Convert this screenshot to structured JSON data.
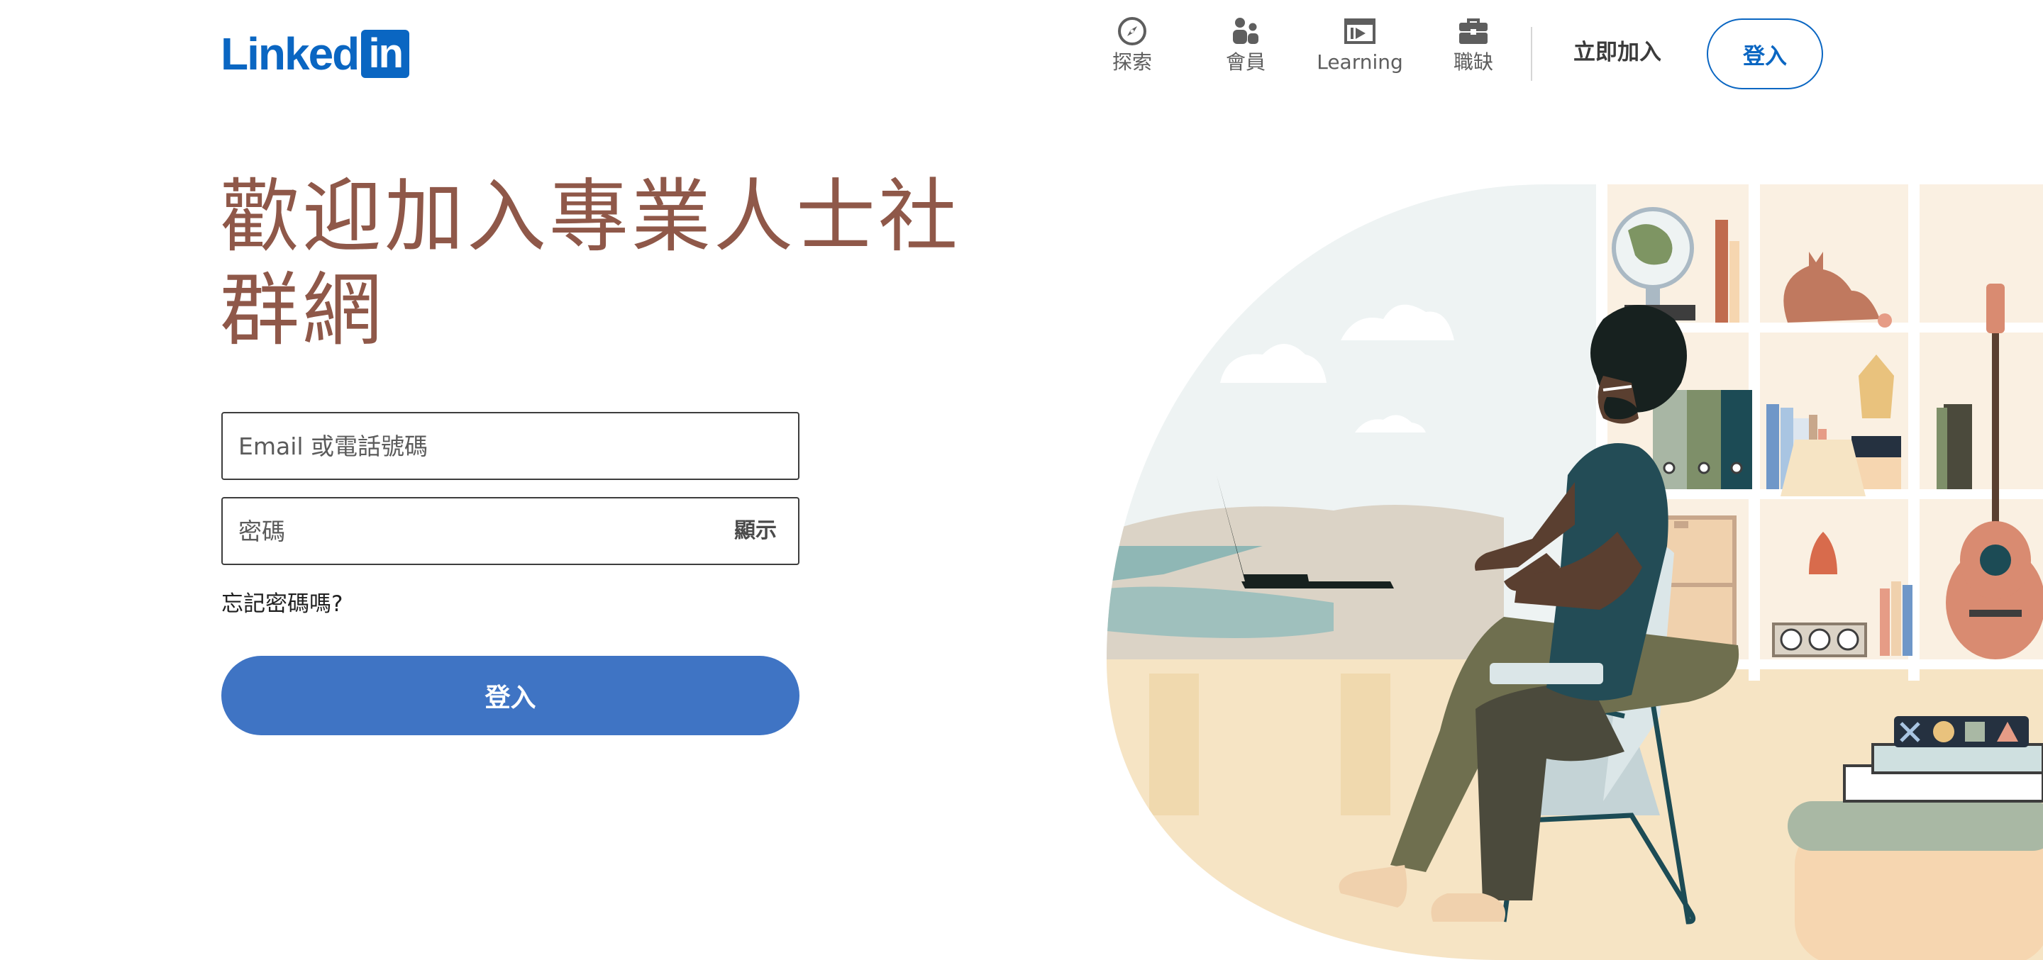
{
  "header": {
    "logo_text": "Linked",
    "logo_badge": "in",
    "nav": [
      {
        "label": "探索",
        "icon": "compass-icon"
      },
      {
        "label": "會員",
        "icon": "people-icon"
      },
      {
        "label": "Learning",
        "icon": "video-play-icon"
      },
      {
        "label": "職缺",
        "icon": "briefcase-icon"
      }
    ],
    "join_label": "立即加入",
    "signin_label": "登入"
  },
  "main": {
    "headline": "歡迎加入專業人士社群網",
    "email_placeholder": "Email 或電話號碼",
    "password_placeholder": "密碼",
    "show_label": "顯示",
    "forgot_label": "忘記密碼嗎?",
    "submit_label": "登入"
  },
  "colors": {
    "brand": "#0a66c2",
    "headline": "#8f5849",
    "submit_bg": "#3f74c4"
  },
  "illustration": {
    "icon": "person-working-on-laptop-illustration"
  }
}
